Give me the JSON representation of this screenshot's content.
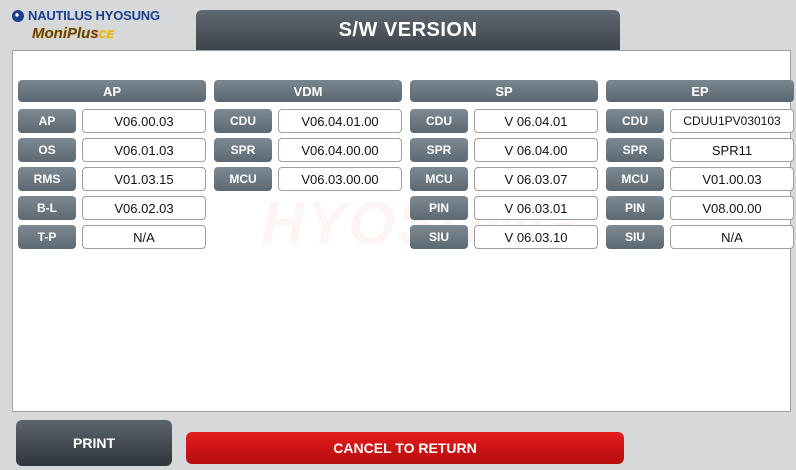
{
  "logo": {
    "brand": "NAUTILUS HYOSUNG",
    "product": "MoniPlus",
    "product_suffix": "CE"
  },
  "title": "S/W VERSION",
  "columns": [
    {
      "header": "AP",
      "rows": [
        {
          "label": "AP",
          "value": "V06.00.03"
        },
        {
          "label": "OS",
          "value": "V06.01.03"
        },
        {
          "label": "RMS",
          "value": "V01.03.15"
        },
        {
          "label": "B-L",
          "value": "V06.02.03"
        },
        {
          "label": "T-P",
          "value": "N/A"
        }
      ]
    },
    {
      "header": "VDM",
      "rows": [
        {
          "label": "CDU",
          "value": "V06.04.01.00"
        },
        {
          "label": "SPR",
          "value": "V06.04.00.00"
        },
        {
          "label": "MCU",
          "value": "V06.03.00.00"
        }
      ]
    },
    {
      "header": "SP",
      "rows": [
        {
          "label": "CDU",
          "value": "V 06.04.01"
        },
        {
          "label": "SPR",
          "value": "V 06.04.00"
        },
        {
          "label": "MCU",
          "value": "V 06.03.07"
        },
        {
          "label": "PIN",
          "value": "V 06.03.01"
        },
        {
          "label": "SIU",
          "value": "V 06.03.10"
        }
      ]
    },
    {
      "header": "EP",
      "rows": [
        {
          "label": "CDU",
          "value": "CDUU1PV030103"
        },
        {
          "label": "SPR",
          "value": "SPR11"
        },
        {
          "label": "MCU",
          "value": "V01.00.03"
        },
        {
          "label": "PIN",
          "value": "V08.00.00"
        },
        {
          "label": "SIU",
          "value": "N/A"
        }
      ]
    }
  ],
  "buttons": {
    "print": "PRINT",
    "cancel": "CANCEL TO RETURN"
  }
}
